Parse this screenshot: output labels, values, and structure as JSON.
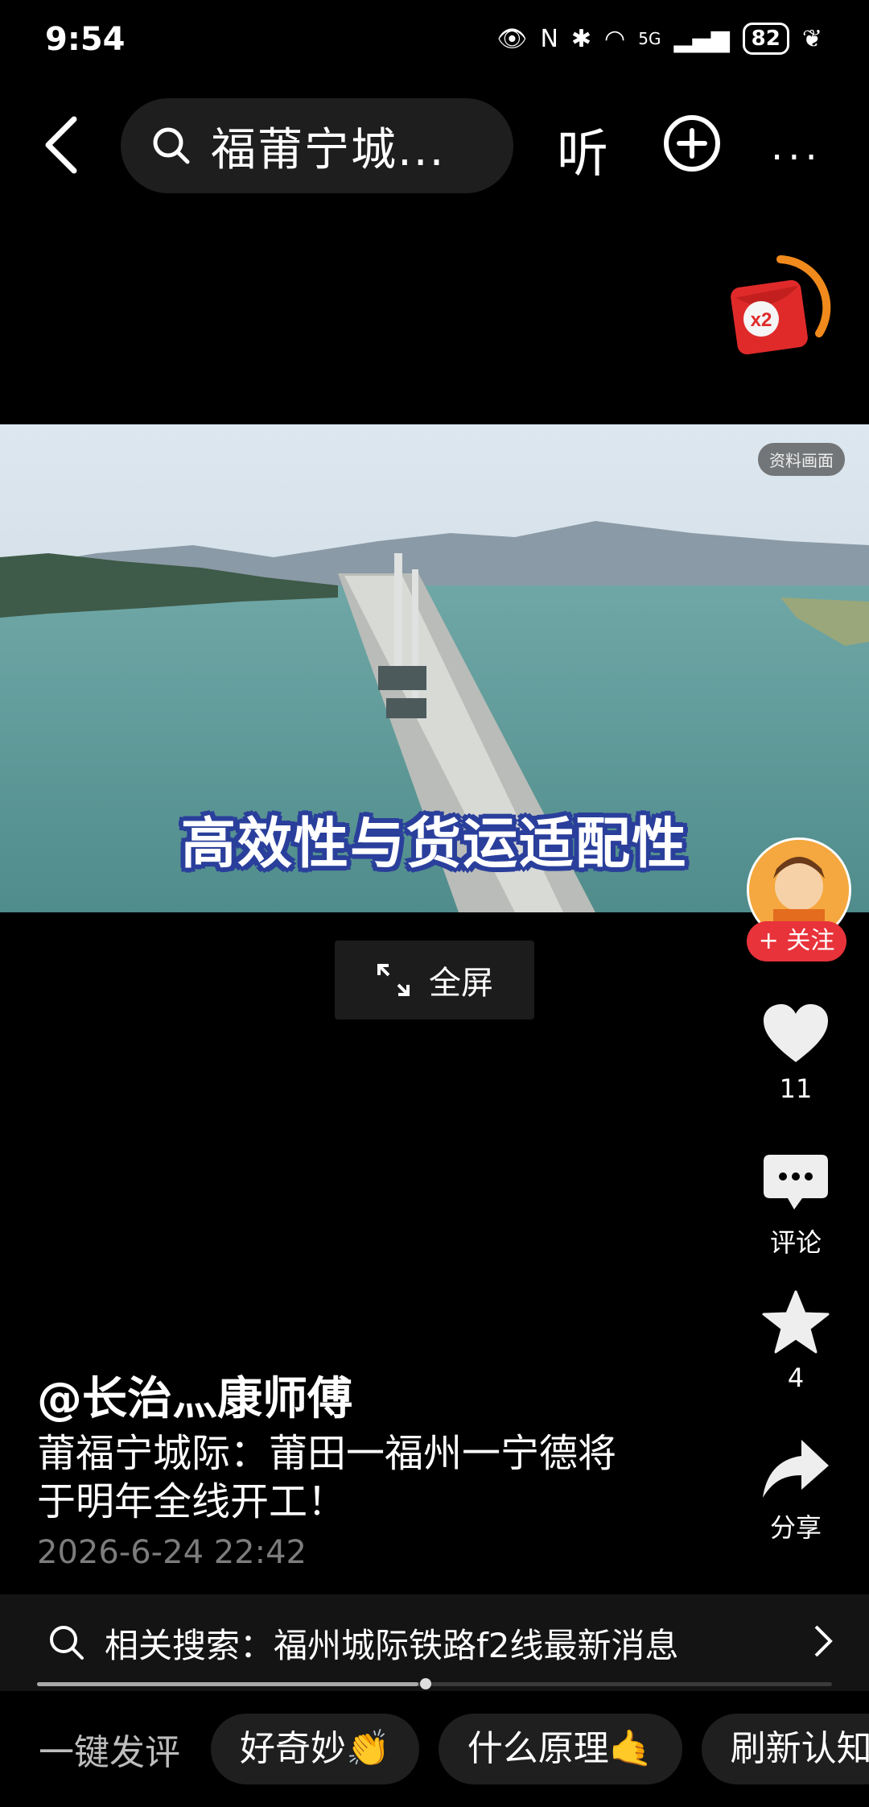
{
  "status": {
    "time": "9:54",
    "battery": "82",
    "network": "5G"
  },
  "topbar": {
    "query": "福莆宁城...",
    "listen_label": "听"
  },
  "video": {
    "material_tag": "资料画面",
    "subtitle": "高效性与货运适配性",
    "fullscreen_label": "全屏"
  },
  "redpacket": {
    "badge": "x2"
  },
  "rail": {
    "follow_label": "+ 关注",
    "likes": "11",
    "comment_label": "评论",
    "favorites": "4",
    "share_label": "分享"
  },
  "caption": {
    "author": "@长治灬康师傅",
    "line1": "莆福宁城际：莆田一福州一宁德将",
    "line2": "于明年全线开工！",
    "date": "2026-6-24 22:42"
  },
  "related": {
    "text": "相关搜索：福州城际铁路f2线最新消息"
  },
  "chips": {
    "lead": "一键发评",
    "items": [
      "好奇妙👏",
      "什么原理🤙",
      "刷新认知"
    ]
  }
}
